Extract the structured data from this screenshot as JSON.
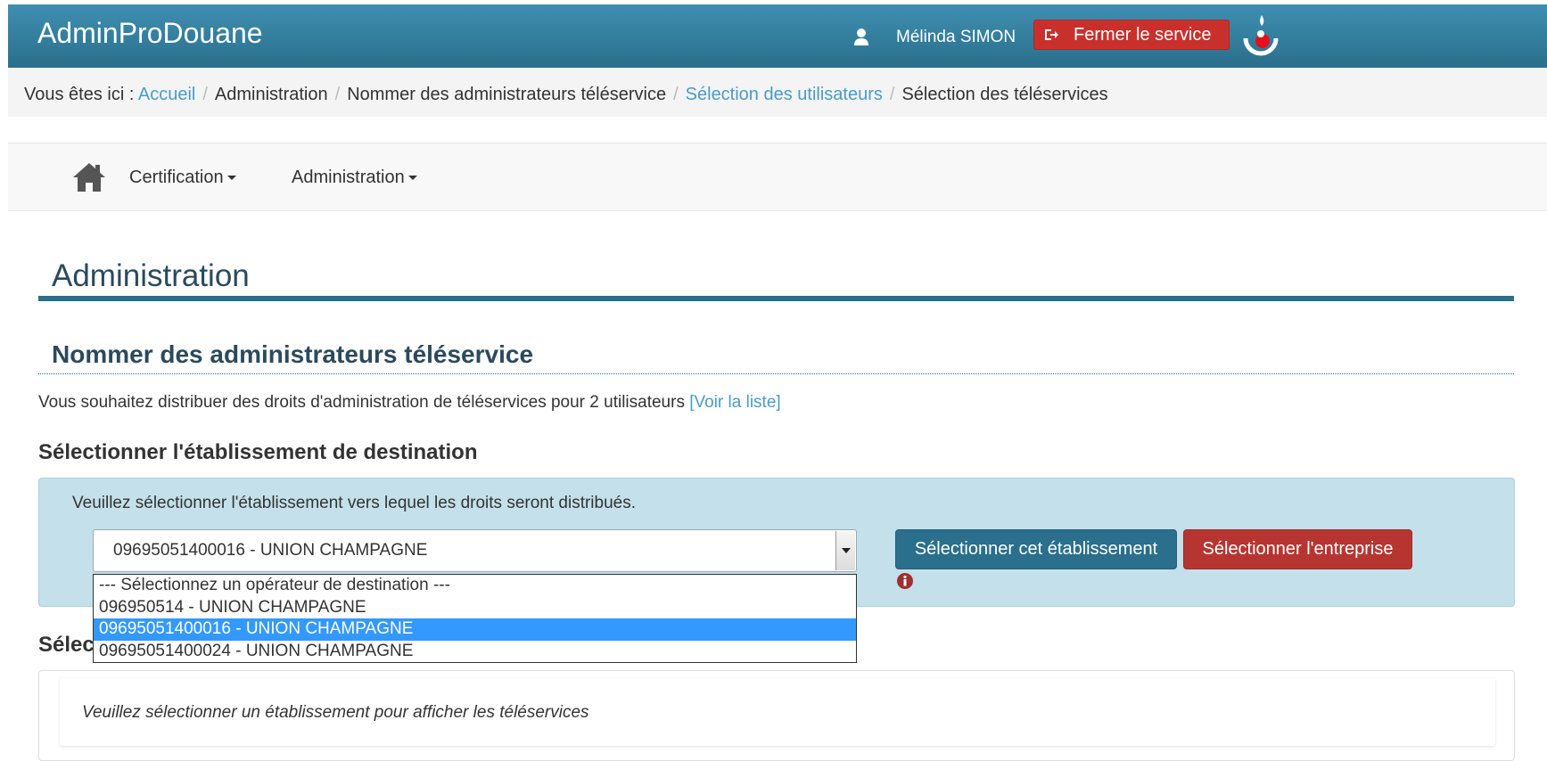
{
  "header": {
    "app_name": "AdminProDouane",
    "user_name": "Mélinda SIMON",
    "logout_label": "Fermer le service"
  },
  "breadcrumb": {
    "prefix": "Vous êtes ici :",
    "items": [
      "Accueil",
      "Administration",
      "Nommer des administrateurs téléservice",
      "Sélection des utilisateurs",
      "Sélection des téléservices"
    ]
  },
  "nav": {
    "items": [
      "Certification",
      "Administration"
    ]
  },
  "page": {
    "title": "Administration",
    "section_title": "Nommer des administrateurs téléservice",
    "intro_text": "Vous souhaitez distribuer des droits d'administration de téléservices pour 2 utilisateurs",
    "intro_link": "[Voir la liste]",
    "select_title": "Sélectionner l'établissement de destination",
    "services_title": "Sélectionner les téléservices"
  },
  "panel": {
    "info": "Veuillez sélectionner l'établissement vers lequel les droits seront distribués.",
    "selected_value": "09695051400016 - UNION CHAMPAGNE",
    "select_button": "Sélectionner cet établissement",
    "enterprise_button": "Sélectionner l'entreprise"
  },
  "dropdown": {
    "options": [
      "--- Sélectionnez un opérateur de destination ---",
      "096950514 - UNION CHAMPAGNE",
      "09695051400016 - UNION CHAMPAGNE",
      "09695051400024 - UNION CHAMPAGNE"
    ],
    "selected_index": 2
  },
  "services": {
    "message": "Veuillez sélectionner un établissement pour afficher les téléservices"
  },
  "colors": {
    "header": "#2a6f8c",
    "link": "#4a9cc4",
    "danger": "#c9302c",
    "info_panel": "#c4e0ea",
    "highlight": "#3399ff"
  }
}
